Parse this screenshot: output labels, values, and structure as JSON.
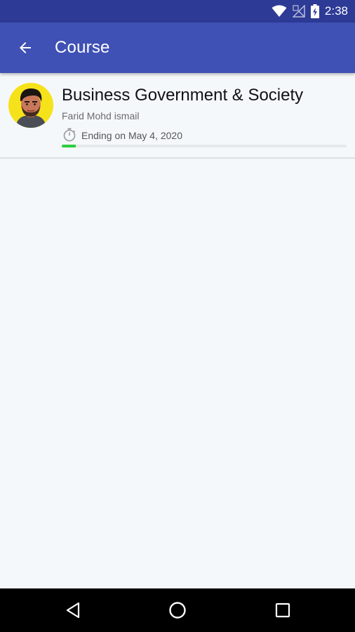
{
  "status_bar": {
    "time": "2:38",
    "icons": [
      "wifi-icon",
      "no-signal-icon",
      "battery-charging-icon"
    ]
  },
  "app_bar": {
    "back_icon": "arrow-back-icon",
    "title": "Course"
  },
  "course": {
    "title": "Business Government & Society",
    "instructor": "Farid Mohd ismail",
    "end_date": "Ending on May 4, 2020",
    "timer_icon": "stopwatch-icon",
    "progress_percent": 5
  },
  "nav_bar": {
    "icons": [
      "back-triangle-icon",
      "home-circle-icon",
      "recents-square-icon"
    ]
  },
  "colors": {
    "status_bar": "#2d3a96",
    "app_bar": "#3f51b5",
    "background": "#f5f8fb",
    "progress": "#2ecc40",
    "avatar_bg": "#f6e21a"
  }
}
